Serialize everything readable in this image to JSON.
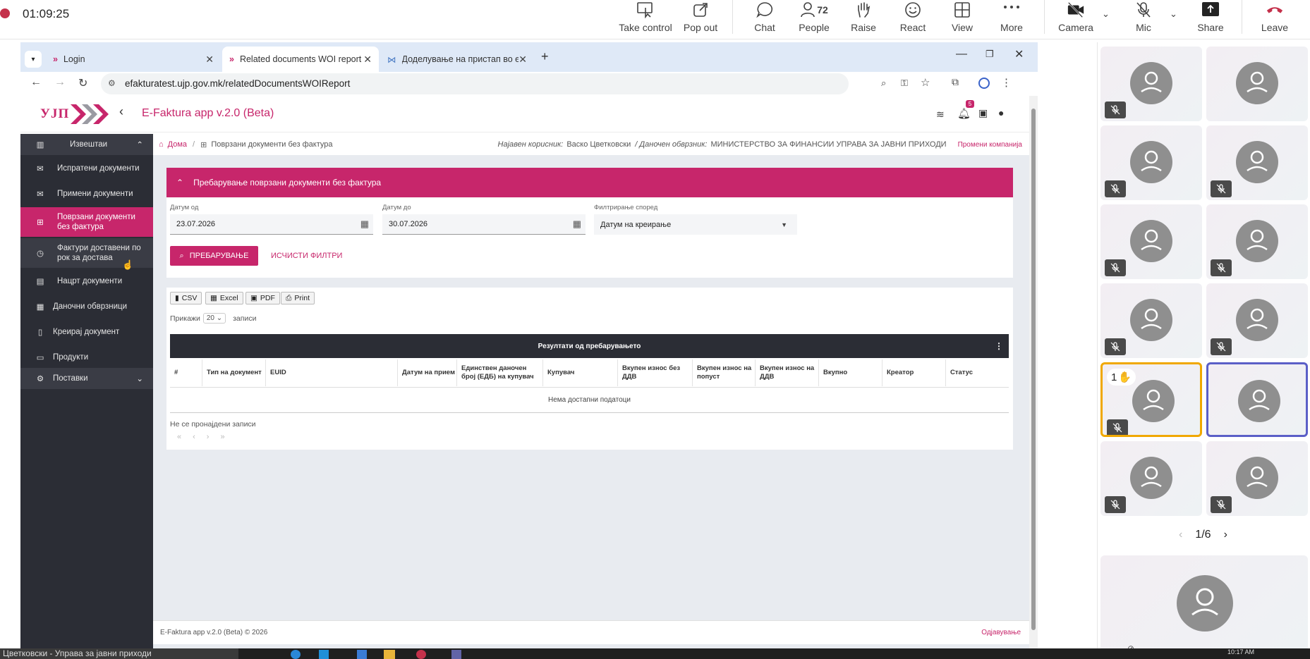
{
  "meeting": {
    "timer": "01:09:25",
    "buttons": {
      "take_control": "Take control",
      "pop_out": "Pop out",
      "chat": "Chat",
      "people": "People",
      "people_count": "72",
      "raise": "Raise",
      "react": "React",
      "view": "View",
      "more": "More",
      "camera": "Camera",
      "mic": "Mic",
      "share": "Share",
      "leave": "Leave"
    },
    "pager": "1/6",
    "raised_hand_count": "1"
  },
  "browser": {
    "tabs": [
      {
        "label": "Login"
      },
      {
        "label": "Related documents WOI report"
      },
      {
        "label": "Доделување на пристап во е-"
      }
    ],
    "url": "efakturatest.ujp.gov.mk/relatedDocumentsWOIReport"
  },
  "app": {
    "logo_text": "УЈП",
    "title": "E-Faktura app v.2.0 (Beta)",
    "notification_count": "5",
    "sidebar": {
      "section_reports": "Извештаи",
      "items": [
        {
          "label": "Испратени документи"
        },
        {
          "label": "Примени документи"
        },
        {
          "label": "Поврзани документи без фактура"
        },
        {
          "label": "Фактури доставени по рок за достава"
        },
        {
          "label": "Нацрт документи"
        },
        {
          "label": "Даночни обврзници"
        },
        {
          "label": "Креирај документ"
        },
        {
          "label": "Продукти"
        }
      ],
      "section_settings": "Поставки"
    },
    "breadcrumb": {
      "home": "Дома",
      "current": "Поврзани документи без фактура",
      "user_label": "Најавен корисник:",
      "user_name": "Васко Цветковски",
      "taxpayer_label": "/ Даночен обврзник:",
      "taxpayer_name": "МИНИСТЕРСТВО ЗА ФИНАНСИИ УПРАВА ЗА ЈАВНИ ПРИХОДИ",
      "change_company": "Промени компанија"
    },
    "search": {
      "header": "Пребарување поврзани документи без фактура",
      "date_from_label": "Датум од",
      "date_from": "23.07.2026",
      "date_to_label": "Датум до",
      "date_to": "30.07.2026",
      "filter_label": "Филтрирање според",
      "filter_value": "Датум на креирање",
      "search_button": "ПРЕБАРУВАЊЕ",
      "clear_button": "ИСЧИСТИ ФИЛТРИ"
    },
    "results": {
      "export": [
        "CSV",
        "Excel",
        "PDF",
        "Print"
      ],
      "show_label": "Прикажи",
      "page_size": "20",
      "records_label": "записи",
      "table_title": "Резултати од пребарувањето",
      "columns": [
        "#",
        "Тип на документ",
        "EUID",
        "Датум на прием",
        "Единствен даночен број (ЕДБ) на купувач",
        "Купувач",
        "Вкупен износ без ДДВ",
        "Вкупен износ на попуст",
        "Вкупен износ на ДДВ",
        "Вкупно",
        "Креатор",
        "Статус"
      ],
      "empty": "Нема достапни податоци",
      "not_found": "Не се пронајдени записи",
      "pager": [
        "«",
        "‹",
        "›",
        "»"
      ]
    },
    "footer": {
      "copyright": "E-Faktura app v.2.0 (Beta) © 2026",
      "logout": "Одјавување"
    }
  },
  "taskbar": {
    "window_title": "Цветковски - Управа за јавни приходи",
    "clock": "10:17 AM"
  },
  "colors": {
    "brand": "#c7266b",
    "sidebar": "#2b2d35",
    "teams_leave": "#c4314b"
  }
}
